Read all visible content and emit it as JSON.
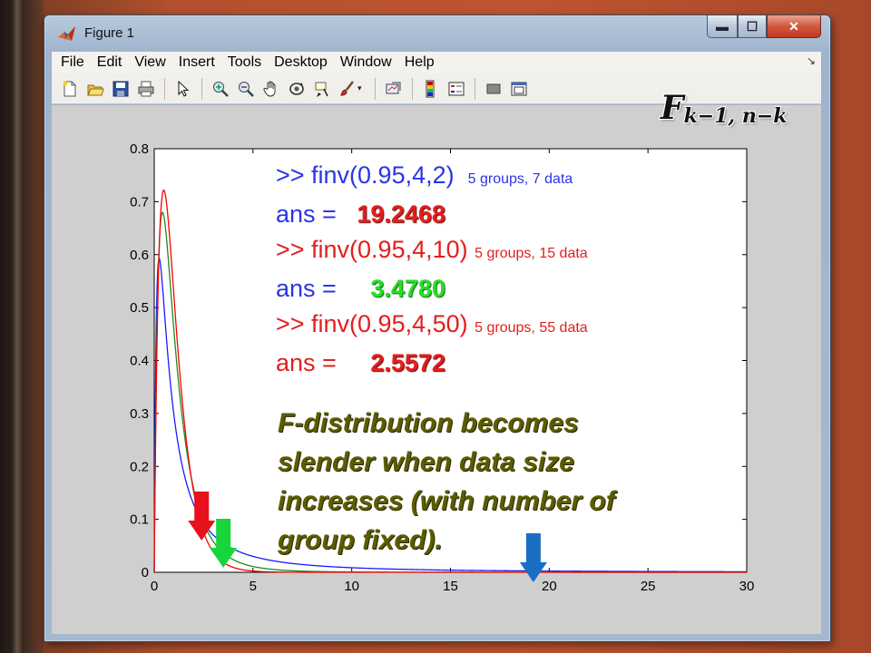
{
  "window": {
    "title": "Figure 1",
    "controls": {
      "minimize": "▬",
      "maximize": "☐",
      "close": "✕"
    }
  },
  "menu": [
    "File",
    "Edit",
    "View",
    "Insert",
    "Tools",
    "Desktop",
    "Window",
    "Help"
  ],
  "menu_corner": "↘",
  "toolbar": {
    "icons": [
      "new-figure-icon",
      "open-file-icon",
      "save-icon",
      "print-icon",
      "arrow-select-icon",
      "zoom-in-icon",
      "zoom-out-icon",
      "pan-hand-icon",
      "rotate-3d-icon",
      "data-cursor-icon",
      "brush-icon",
      "link-plot-icon",
      "colorbar-icon",
      "legend-icon",
      "hide-tools-icon",
      "show-tools-icon"
    ]
  },
  "formula": {
    "main": "F",
    "subscript": "k−1, n−k"
  },
  "annotations": [
    {
      "cmd": ">> finv(0.95,4,2)",
      "note": "5 groups, 7 data",
      "ans_label": "ans =",
      "ans_value": "19.2468",
      "value_color": "red"
    },
    {
      "cmd": ">> finv(0.95,4,10)",
      "note": "5 groups, 15 data",
      "ans_label": "ans =",
      "ans_value": "3.4780",
      "value_color": "green"
    },
    {
      "cmd": ">> finv(0.95,4,50)",
      "note": "5 groups, 55 data",
      "ans_label": "ans =",
      "ans_value": "2.5572",
      "value_color": "red"
    }
  ],
  "conclusion": [
    "F-distribution becomes",
    "slender when data size",
    "increases (with number of",
    "group fixed)."
  ],
  "arrows": [
    {
      "color": "#e8101a",
      "x_value": 2.4
    },
    {
      "color": "#16d63a",
      "x_value": 3.5
    },
    {
      "color": "#1a6fc4",
      "x_value": 19.2
    }
  ],
  "chart_data": {
    "type": "line",
    "title": "",
    "xlabel": "",
    "ylabel": "",
    "xlim": [
      0,
      30
    ],
    "ylim": [
      0,
      0.8
    ],
    "xticks": [
      0,
      5,
      10,
      15,
      20,
      25,
      30
    ],
    "yticks": [
      0,
      0.1,
      0.2,
      0.3,
      0.4,
      0.5,
      0.6,
      0.7,
      0.8
    ],
    "xticklabels": [
      "0",
      "5",
      "10",
      "15",
      "20",
      "25",
      "30"
    ],
    "yticklabels": [
      "0",
      "0.1",
      "0.2",
      "0.3",
      "0.4",
      "0.5",
      "0.6",
      "0.7",
      "0.8"
    ],
    "grid": false,
    "series": [
      {
        "color": "#1a1aff",
        "df1": 4,
        "df2": 2
      },
      {
        "color": "#1e8a1e",
        "df1": 4,
        "df2": 10
      },
      {
        "color": "#ff0000",
        "df1": 4,
        "df2": 50
      }
    ]
  }
}
